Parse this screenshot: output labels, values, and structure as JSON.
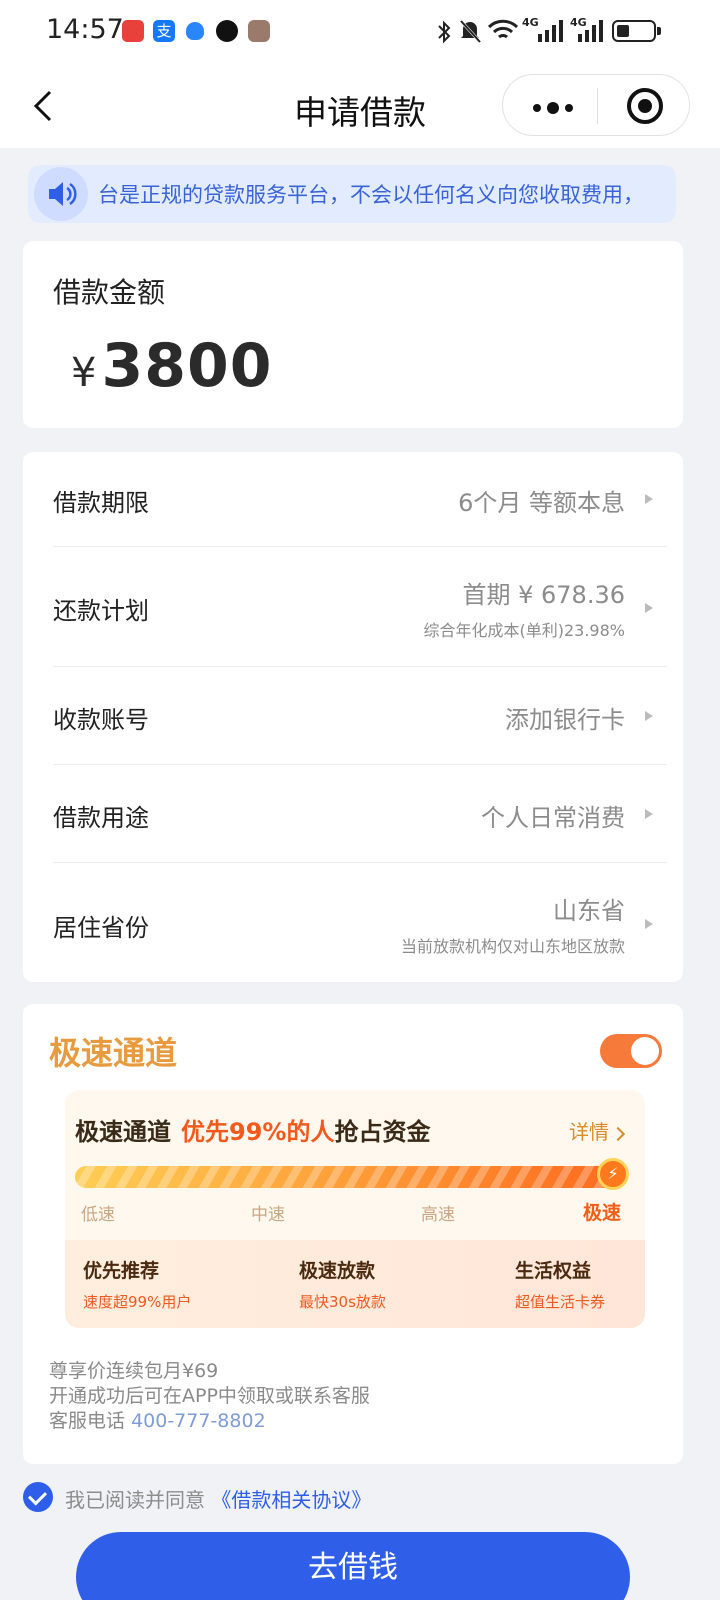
{
  "status_bar": {
    "time": "14:57",
    "app_icons": [
      {
        "name": "red-app-icon",
        "color": "#e8413b"
      },
      {
        "name": "alipay-icon",
        "color": "#1677ff"
      },
      {
        "name": "shield-app-icon",
        "color": "#2a86ff"
      },
      {
        "name": "qq-icon",
        "color": "#111111"
      },
      {
        "name": "avatar-app-icon",
        "color": "#9a7a6a"
      }
    ],
    "network_a": "4G",
    "network_b": "4G"
  },
  "nav": {
    "title": "申请借款"
  },
  "notice": {
    "text": "台是正规的贷款服务平台，不会以任何名义向您收取费用，"
  },
  "amount": {
    "label": "借款金额",
    "currency": "¥",
    "value": "3800"
  },
  "rows": {
    "term": {
      "label": "借款期限",
      "value": "6个月 等额本息"
    },
    "plan": {
      "label": "还款计划",
      "value": "首期 ¥ 678.36",
      "sub": "综合年化成本(单利)23.98%"
    },
    "account": {
      "label": "收款账号",
      "value": "添加银行卡"
    },
    "purpose": {
      "label": "借款用途",
      "value": "个人日常消费"
    },
    "province": {
      "label": "居住省份",
      "value": "山东省",
      "sub": "当前放款机构仅对山东地区放款"
    }
  },
  "speed": {
    "title": "极速通道",
    "toggle_on": true,
    "promo": {
      "head_a": "极速通道",
      "head_b": "优先99%的人",
      "head_c": "抢占资金",
      "detail": "详情",
      "levels": [
        "低速",
        "中速",
        "高速",
        "极速"
      ],
      "benefits": [
        {
          "title": "优先推荐",
          "sub": "速度超99%用户"
        },
        {
          "title": "极速放款",
          "sub": "最快30s放款"
        },
        {
          "title": "生活权益",
          "sub": "超值生活卡券"
        }
      ]
    },
    "info_line1": "尊享价连续包月¥69",
    "info_line2": "开通成功后可在APP中领取或联系客服",
    "info_phone_label": "客服电话",
    "info_phone": "400-777-8802"
  },
  "agreement": {
    "text": "我已阅读并同意",
    "link": "《借款相关协议》",
    "checked": true
  },
  "submit": {
    "label": "去借钱"
  },
  "colors": {
    "primary": "#2f5fe8",
    "orange": "#f25a1d",
    "speed_title": "#e89a3e"
  }
}
